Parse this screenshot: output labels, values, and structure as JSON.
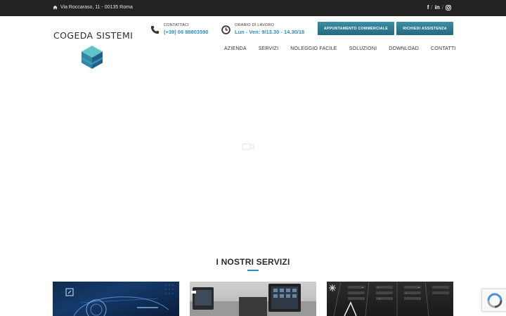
{
  "topbar": {
    "address": "Via Roccaraso, 11 - 00135 Roma",
    "social": {
      "facebook": "f",
      "linkedin": "in",
      "instagram": "instagram",
      "separator": "/"
    }
  },
  "header": {
    "logo_text": "COGEDA SISTEMI",
    "contact": {
      "label": "CONTATTACI",
      "value": "(+39) 06 88803590"
    },
    "hours": {
      "label": "ORARIO DI LAVORO",
      "value": "Lun - Ven: 9/13.30 - 14.30/18"
    },
    "buttons": {
      "appointment": "APPUNTAMENTO COMMERCIALE",
      "assistance": "RICHIEDI ASSISTENZA"
    }
  },
  "nav": {
    "items": [
      "AZIENDA",
      "SERVIZI",
      "NOLEGGIO FACILE",
      "SOLUZIONI",
      "DOWNLOAD",
      "CONTATTI"
    ]
  },
  "services": {
    "title": "I NOSTRI SERVIZI"
  },
  "colors": {
    "accent": "#2a8ec3",
    "button": "#2f7d93",
    "topbar": "#222222"
  },
  "icons": [
    "home-icon",
    "phone-icon",
    "clock-icon",
    "facebook-icon",
    "linkedin-icon",
    "instagram-icon",
    "video-icon",
    "recaptcha-icon"
  ]
}
